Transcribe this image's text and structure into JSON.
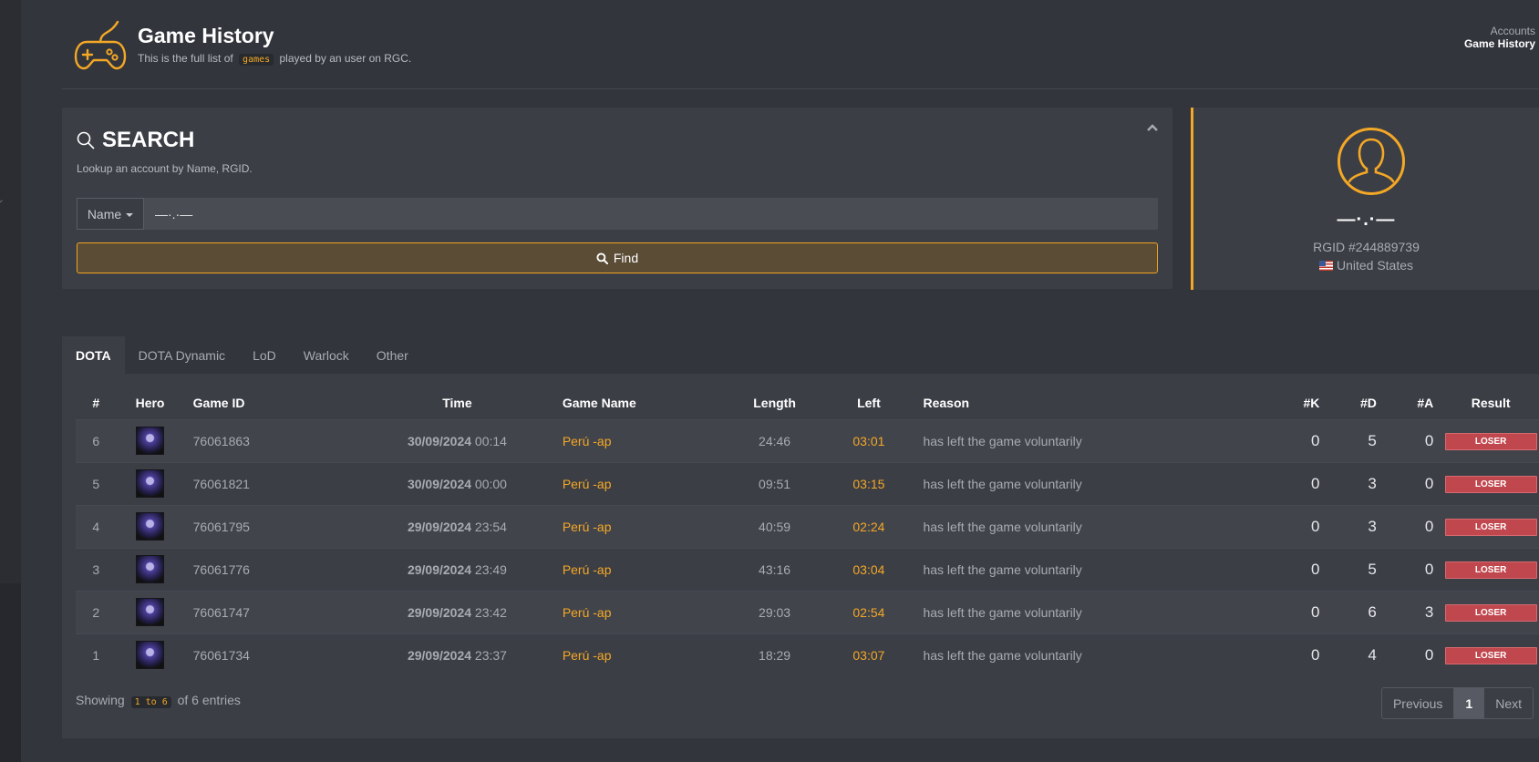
{
  "header": {
    "title": "Game History",
    "subtitle_pre": "This is the full list of",
    "subtitle_code": "games",
    "subtitle_post": "played by an user on RGC.",
    "breadcrumb": [
      "Accounts",
      "Game History"
    ]
  },
  "search": {
    "title": "SEARCH",
    "description": "Lookup an account by Name, RGID.",
    "field_selector": "Name",
    "value": "—·.·—",
    "find_label": "Find"
  },
  "profile": {
    "name": "—·.·—",
    "rgid": "RGID #244889739",
    "country": "United States"
  },
  "tabs": [
    "DOTA",
    "DOTA Dynamic",
    "LoD",
    "Warlock",
    "Other"
  ],
  "table": {
    "headers": [
      "#",
      "Hero",
      "Game ID",
      "Time",
      "Game Name",
      "Length",
      "Left",
      "Reason",
      "#K",
      "#D",
      "#A",
      "Result"
    ],
    "rows": [
      {
        "num": "6",
        "game_id": "76061863",
        "date": "30/09/2024",
        "clock": "00:14",
        "game_name": "Perú -ap",
        "length": "24:46",
        "left": "03:01",
        "reason": "has left the game voluntarily",
        "k": "0",
        "d": "5",
        "a": "0",
        "result": "LOSER"
      },
      {
        "num": "5",
        "game_id": "76061821",
        "date": "30/09/2024",
        "clock": "00:00",
        "game_name": "Perú -ap",
        "length": "09:51",
        "left": "03:15",
        "reason": "has left the game voluntarily",
        "k": "0",
        "d": "3",
        "a": "0",
        "result": "LOSER"
      },
      {
        "num": "4",
        "game_id": "76061795",
        "date": "29/09/2024",
        "clock": "23:54",
        "game_name": "Perú -ap",
        "length": "40:59",
        "left": "02:24",
        "reason": "has left the game voluntarily",
        "k": "0",
        "d": "3",
        "a": "0",
        "result": "LOSER"
      },
      {
        "num": "3",
        "game_id": "76061776",
        "date": "29/09/2024",
        "clock": "23:49",
        "game_name": "Perú -ap",
        "length": "43:16",
        "left": "03:04",
        "reason": "has left the game voluntarily",
        "k": "0",
        "d": "5",
        "a": "0",
        "result": "LOSER"
      },
      {
        "num": "2",
        "game_id": "76061747",
        "date": "29/09/2024",
        "clock": "23:42",
        "game_name": "Perú -ap",
        "length": "29:03",
        "left": "02:54",
        "reason": "has left the game voluntarily",
        "k": "0",
        "d": "6",
        "a": "3",
        "result": "LOSER"
      },
      {
        "num": "1",
        "game_id": "76061734",
        "date": "29/09/2024",
        "clock": "23:37",
        "game_name": "Perú -ap",
        "length": "18:29",
        "left": "03:07",
        "reason": "has left the game voluntarily",
        "k": "0",
        "d": "4",
        "a": "0",
        "result": "LOSER"
      }
    ]
  },
  "footer": {
    "showing_pre": "Showing",
    "showing_range": "1 to 6",
    "showing_post": "of 6 entries",
    "prev_label": "Previous",
    "page": "1",
    "next_label": "Next"
  },
  "colors": {
    "accent": "#f4a825",
    "loser": "#c0474e",
    "panel": "#3c3e46",
    "background": "#33353d"
  }
}
